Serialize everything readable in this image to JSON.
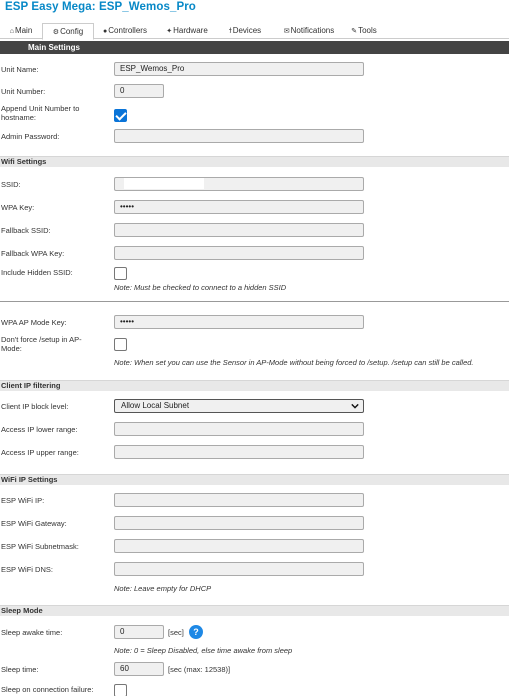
{
  "app": {
    "title": "ESP Easy Mega: ESP_Wemos_Pro"
  },
  "tabs": [
    {
      "label": "Main",
      "icon": "home-icon"
    },
    {
      "label": "Config",
      "icon": "gear-icon"
    },
    {
      "label": "Controllers",
      "icon": "chat-icon"
    },
    {
      "label": "Hardware",
      "icon": "pin-icon"
    },
    {
      "label": "Devices",
      "icon": "plug-icon"
    },
    {
      "label": "Notifications",
      "icon": "mail-icon"
    },
    {
      "label": "Tools",
      "icon": "wrench-icon"
    }
  ],
  "main_settings": {
    "header": "Main Settings",
    "unit_name_label": "Unit Name:",
    "unit_name_value": "ESP_Wemos_Pro",
    "unit_number_label": "Unit Number:",
    "unit_number_value": "0",
    "append_label": "Append Unit Number to hostname:",
    "append_checked": true,
    "admin_password_label": "Admin Password:",
    "admin_password_value": ""
  },
  "wifi": {
    "header": "Wifi Settings",
    "ssid_label": "SSID:",
    "ssid_value": "",
    "wpa_key_label": "WPA Key:",
    "wpa_key_value": "•••••",
    "fallback_ssid_label": "Fallback SSID:",
    "fallback_wpa_label": "Fallback WPA Key:",
    "hidden_ssid_label": "Include Hidden SSID:",
    "hidden_ssid_note": "Note: Must be checked to connect to a hidden SSID",
    "ap_key_label": "WPA AP Mode Key:",
    "ap_key_value": "•••••",
    "dont_force_label": "Don't force /setup in AP-Mode:",
    "dont_force_note": "Note: When set you can use the Sensor in AP-Mode without being forced to /setup. /setup can still be called."
  },
  "client_ip": {
    "header": "Client IP filtering",
    "block_level_label": "Client IP block level:",
    "block_level_value": "Allow Local Subnet",
    "lower_label": "Access IP lower range:",
    "upper_label": "Access IP upper range:"
  },
  "wifi_ip": {
    "header": "WiFi IP Settings",
    "ip_label": "ESP WiFi IP:",
    "gateway_label": "ESP WiFi Gateway:",
    "subnet_label": "ESP WiFi Subnetmask:",
    "dns_label": "ESP WiFi DNS:",
    "note": "Note: Leave empty for DHCP"
  },
  "sleep": {
    "header": "Sleep Mode",
    "awake_label": "Sleep awake time:",
    "awake_value": "0",
    "awake_unit": "[sec]",
    "help_icon": "?",
    "awake_note": "Note: 0 = Sleep Disabled, else time awake from sleep",
    "sleep_time_label": "Sleep time:",
    "sleep_time_value": "60",
    "sleep_time_unit": "[sec (max: 12538)]",
    "failure_label": "Sleep on connection failure:"
  },
  "colors": {
    "title": "#0788c7",
    "header_bg": "#444444",
    "accent": "#0a74d8"
  }
}
